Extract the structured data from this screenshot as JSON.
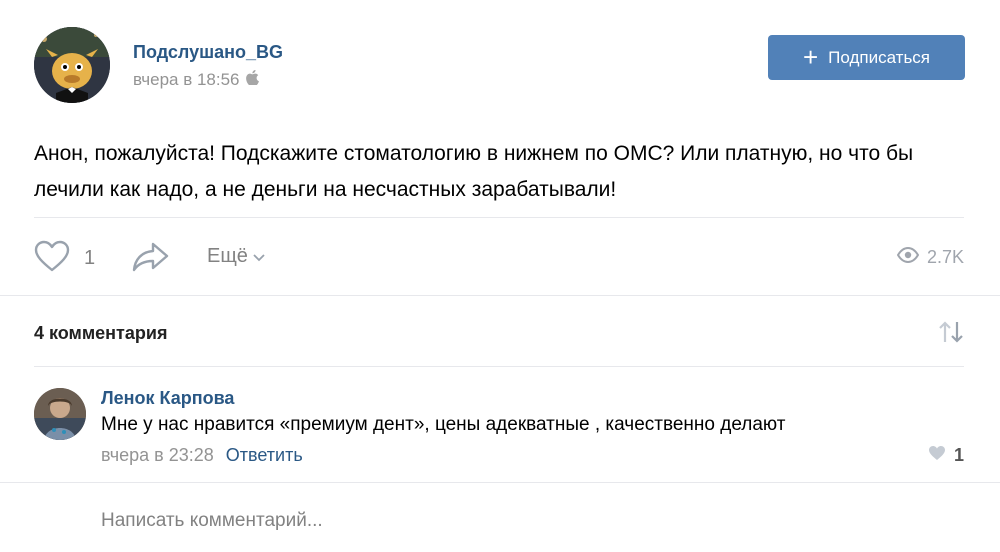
{
  "post": {
    "group_name": "Подслушано_BG",
    "time": "вчера в 18:56",
    "subscribe_label": "Подписаться",
    "text": "Анон, пожалуйста! Подскажите стоматологию в нижнем по ОМС? Или платную, но что бы лечили как надо, а не деньги на несчастных зарабатывали!",
    "likes": "1",
    "more_label": "Ещё",
    "views": "2.7K"
  },
  "comments": {
    "count_label": "4 комментария",
    "items": [
      {
        "author": "Ленок Карпова",
        "text": "Мне у нас нравится «премиум дент», цены адекватные , качественно делают",
        "time": "вчера в 23:28",
        "reply_label": "Ответить",
        "likes": "1"
      }
    ]
  },
  "composer": {
    "placeholder": "Написать комментарий..."
  },
  "colors": {
    "link": "#2a5885",
    "button": "#5181b8",
    "muted": "#939393",
    "divider": "#e7e8ec"
  },
  "icons": {
    "platform": "apple-icon",
    "like": "heart-outline-icon",
    "share": "share-arrow-icon",
    "more": "chevron-down-icon",
    "views": "eye-icon",
    "sort": "sort-arrows-icon",
    "comment_like": "heart-filled-icon"
  }
}
